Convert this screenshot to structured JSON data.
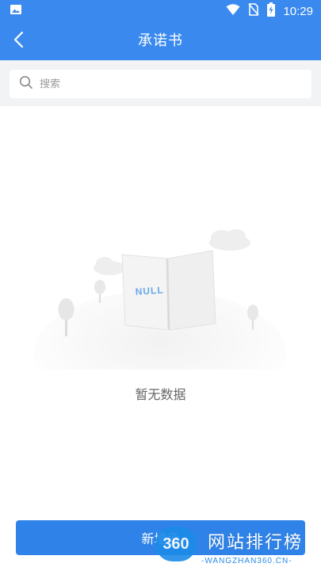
{
  "status_bar": {
    "time": "10:29",
    "icons": [
      "image-icon",
      "wifi-icon",
      "no-sim-icon",
      "battery-charging-icon"
    ]
  },
  "app_bar": {
    "title": "承诺书",
    "back_icon": "chevron-left-icon"
  },
  "search": {
    "placeholder": "搜索",
    "icon": "search-icon"
  },
  "empty_state": {
    "book_label": "NULL",
    "message": "暂无数据"
  },
  "bottom_button": {
    "label": "新增承"
  },
  "watermark": {
    "logo_text": "360",
    "title": "网站排行榜",
    "subtitle": "-WANGZHAN360.CN-"
  },
  "colors": {
    "primary": "#3a89ef",
    "button": "#2f83e8",
    "search_bg": "#f2f3f5",
    "empty_text": "#666666"
  }
}
